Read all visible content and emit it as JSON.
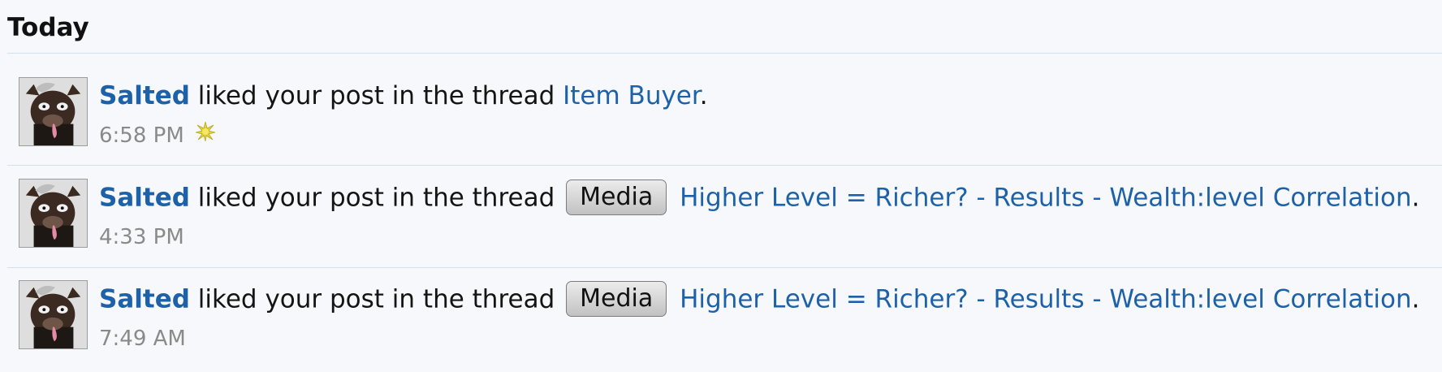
{
  "section": {
    "title": "Today"
  },
  "alerts": [
    {
      "user": "Salted",
      "action": "liked your post in the thread",
      "prefix": "",
      "thread": "Item Buyer",
      "suffix": ".",
      "time": "6:58 PM",
      "is_new": true
    },
    {
      "user": "Salted",
      "action": "liked your post in the thread",
      "prefix": "Media",
      "thread": "Higher Level = Richer? - Results - Wealth:level Correlation",
      "suffix": ".",
      "time": "4:33 PM",
      "is_new": false
    },
    {
      "user": "Salted",
      "action": "liked your post in the thread",
      "prefix": "Media",
      "thread": "Higher Level = Richer? - Results - Wealth:level Correlation",
      "suffix": ".",
      "time": "7:49 AM",
      "is_new": false
    }
  ],
  "icons": {
    "avatar": "bull-avatar-icon",
    "new": "new-star-icon"
  },
  "colors": {
    "link": "#1d61a8",
    "background": "#f7f8fc",
    "divider": "#cfe2f2",
    "time": "#8a8a8a"
  }
}
